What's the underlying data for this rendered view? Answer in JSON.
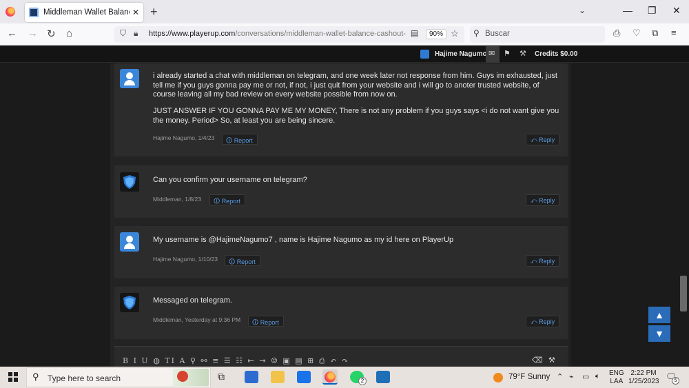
{
  "browser": {
    "tab_title": "Middleman Wallet Balance Cashout",
    "url_domain": "https://www.playerup.com",
    "url_path": "/conversations/middleman-wallet-balance-cashout-",
    "zoom": "90%",
    "search_placeholder": "Buscar"
  },
  "site_header": {
    "username": "Hajime Nagumo",
    "credits": "Credits $0.00"
  },
  "posts": [
    {
      "paragraph1": "i already started a chat with middleman on telegram, and one week later not response from him. Guys im exhausted, just tell me if you guys gonna pay me or not, if not, i just quit from your website and i will go to anoter trusted website, of course leaving all my bad review on every website possible from now on.",
      "paragraph2": "JUST ANSWER IF YOU GONNA PAY ME MY MONEY, There is not any problem if you guys says <i do not want give you the money. Period> So, at least you are being sincere.",
      "meta": "Hajime Nagumo, 1/4/23"
    },
    {
      "text": "Can you confirm your username on telegram?",
      "meta": "Middleman, 1/8/23"
    },
    {
      "text": "My username is @HajimeNagumo7 , name is Hajime Nagumo as my id here on PlayerUp",
      "meta": "Hajime Nagumo, 1/10/23"
    },
    {
      "text": "Messaged on telegram.",
      "meta": "Middleman, Yesterday at 9:36 PM"
    }
  ],
  "actions": {
    "report": "Report",
    "reply": "Reply"
  },
  "editor": {
    "toolbar": "B I U ◍ TI A ⚲ ⚯ ≡ ☰ ☷ ⇤ ⇥ ☺ ▣ ▤ ⊞ ⎙ ↶ ↷"
  },
  "taskbar": {
    "search_placeholder": "Type here to search",
    "weather": "79°F  Sunny",
    "lang_top": "ENG",
    "lang_bottom": "LAA",
    "time": "2:22 PM",
    "date": "1/25/2023",
    "whatsapp_badge": "2",
    "notifications_badge": "5"
  },
  "colors": {
    "accent": "#5b9de6",
    "avatar_user": "#3b86d8",
    "jump_buttons": "#2b6cb8"
  }
}
